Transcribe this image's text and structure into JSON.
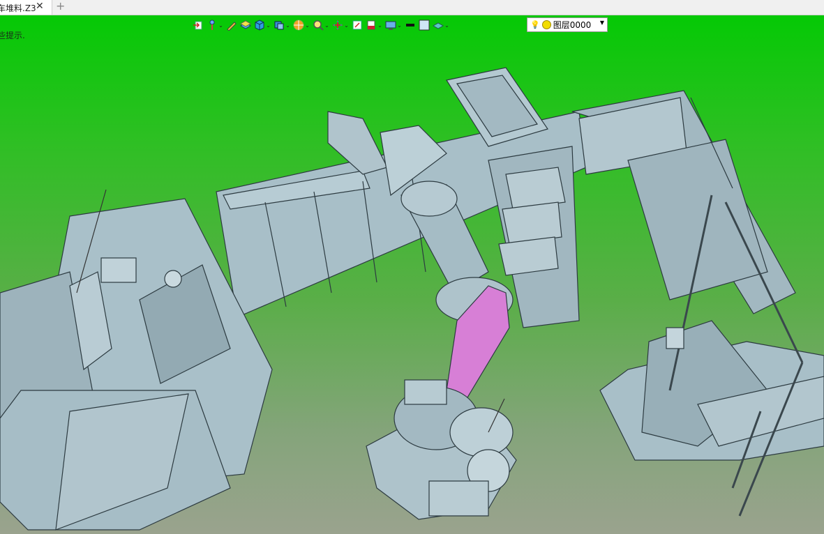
{
  "tab": {
    "title": "车堆料.Z3",
    "close_icon": "close-icon",
    "add_icon": "plus-icon"
  },
  "viewport": {
    "hint": "些提示."
  },
  "toolbar": {
    "buttons": [
      {
        "name": "import-icon"
      },
      {
        "name": "pointer-icon"
      },
      {
        "name": "pen-icon"
      },
      {
        "name": "layer-stack-icon"
      },
      {
        "name": "cube-icon"
      },
      {
        "name": "view-cube-icon"
      },
      {
        "name": "render-ball-icon"
      },
      {
        "name": "zoom-icon"
      },
      {
        "name": "pan-icon"
      },
      {
        "name": "fit-view-icon"
      },
      {
        "name": "section-icon"
      },
      {
        "name": "display-icon"
      },
      {
        "name": "line-color-icon"
      },
      {
        "name": "fill-color-icon"
      },
      {
        "name": "material-icon"
      }
    ],
    "layer": {
      "bulb_icon": "bulb-icon",
      "value": "图层0000"
    }
  },
  "colors": {
    "bg_top": "#05c905",
    "bg_bottom": "#9aa38e",
    "part": "#a8bfc8",
    "highlight": "#d77fd6"
  }
}
